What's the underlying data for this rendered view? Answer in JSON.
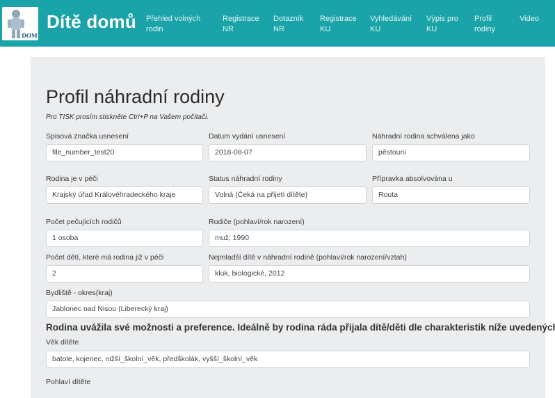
{
  "header": {
    "brand": "Dítě domů",
    "logo_text": "DOMŮ",
    "nav": [
      {
        "line1": "Přehled volných",
        "line2": "rodin"
      },
      {
        "line1": "Registrace",
        "line2": "NR"
      },
      {
        "line1": "Dotazník",
        "line2": "NR"
      },
      {
        "line1": "Registrace",
        "line2": "KU"
      },
      {
        "line1": "Vyhledávání",
        "line2": "KU"
      },
      {
        "line1": "Výpis pro",
        "line2": "KU"
      },
      {
        "line1": "Profil",
        "line2": "rodiny"
      },
      {
        "line1": "Video",
        "line2": ""
      }
    ],
    "colors": {
      "navbar": "#1aa3a8",
      "panel": "#ebedef"
    }
  },
  "page": {
    "title": "Profil náhradní rodiny",
    "note": "Pro TISK prosím stiskněte Ctrl+P na Vašem počítači."
  },
  "fields": {
    "spisova": {
      "label": "Spisová značka usnesení",
      "value": "file_number_test20"
    },
    "datum": {
      "label": "Datum vydání usnesení",
      "value": "2018-08-07"
    },
    "schvalena": {
      "label": "Náhradní rodina schválena jako",
      "value": "pěstouni"
    },
    "pece": {
      "label": "Rodina je v péči",
      "value": "Krajský úřad Královéhradeckého kraje"
    },
    "status": {
      "label": "Status náhradní rodiny",
      "value": "Volná (Čeká na přijetí dítěte)"
    },
    "pripravka": {
      "label": "Přípravka absolvována u",
      "value": "Routa"
    },
    "pocet_rodicu": {
      "label": "Počet pečujících rodičů",
      "value": "1 osoba"
    },
    "rodice": {
      "label": "Rodiče (pohlaví/rok narození)",
      "value": "muž; 1990"
    },
    "pocet_deti": {
      "label": "Počet dětí, které má rodina již v péči",
      "value": "2"
    },
    "nejmladsi": {
      "label": "Nejmladší dítě v náhradní rodině (pohlaví/rok narození/vztah)",
      "value": "kluk, biologické, 2012"
    },
    "bydliste": {
      "label": "Bydliště - okres(kraj)",
      "value": "Jablonec nad Nisou (Liberecký kraj)"
    }
  },
  "preferences": {
    "heading": "Rodina uvážila své možnosti a preference. Ideálně by rodina ráda přijala dítě/děti dle charakteristik níže uvedených.",
    "vek": {
      "label": "Věk dítěte",
      "value": "batole, kojenec, nižší_školní_věk, předškolák, vyšší_školní_věk"
    },
    "pohlavi": {
      "label": "Pohlaví dítěte"
    }
  }
}
